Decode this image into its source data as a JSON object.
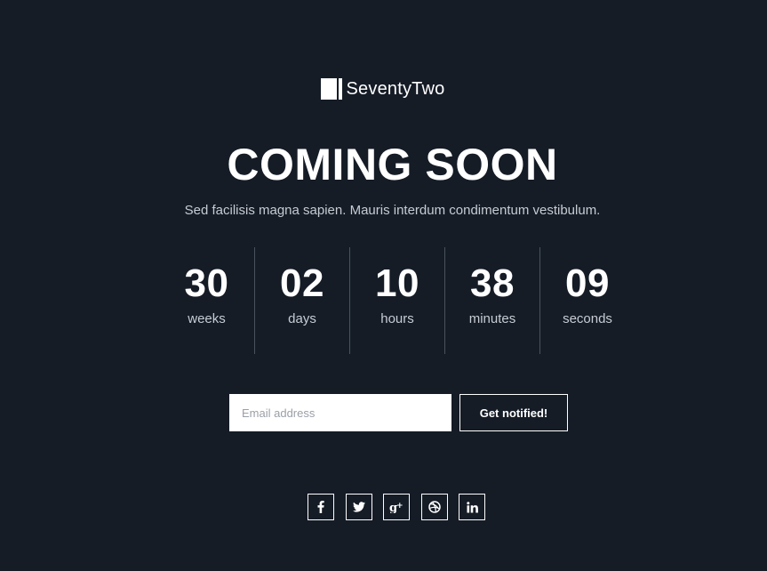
{
  "logo": {
    "text": "SeventyTwo"
  },
  "hero": {
    "title": "COMING SOON",
    "subtitle": "Sed facilisis magna sapien. Mauris interdum condimentum vestibulum."
  },
  "countdown": [
    {
      "value": "30",
      "label": "weeks"
    },
    {
      "value": "02",
      "label": "days"
    },
    {
      "value": "10",
      "label": "hours"
    },
    {
      "value": "38",
      "label": "minutes"
    },
    {
      "value": "09",
      "label": "seconds"
    }
  ],
  "form": {
    "email_placeholder": "Email address",
    "email_value": "",
    "submit_label": "Get notified!"
  },
  "social": [
    {
      "icon": "facebook-icon"
    },
    {
      "icon": "twitter-icon"
    },
    {
      "icon": "google-plus-icon"
    },
    {
      "icon": "dribbble-icon"
    },
    {
      "icon": "linkedin-icon"
    }
  ],
  "colors": {
    "background": "#151c26",
    "text": "#ffffff",
    "muted_text": "#c7ccd3",
    "divider": "#4a525d"
  }
}
